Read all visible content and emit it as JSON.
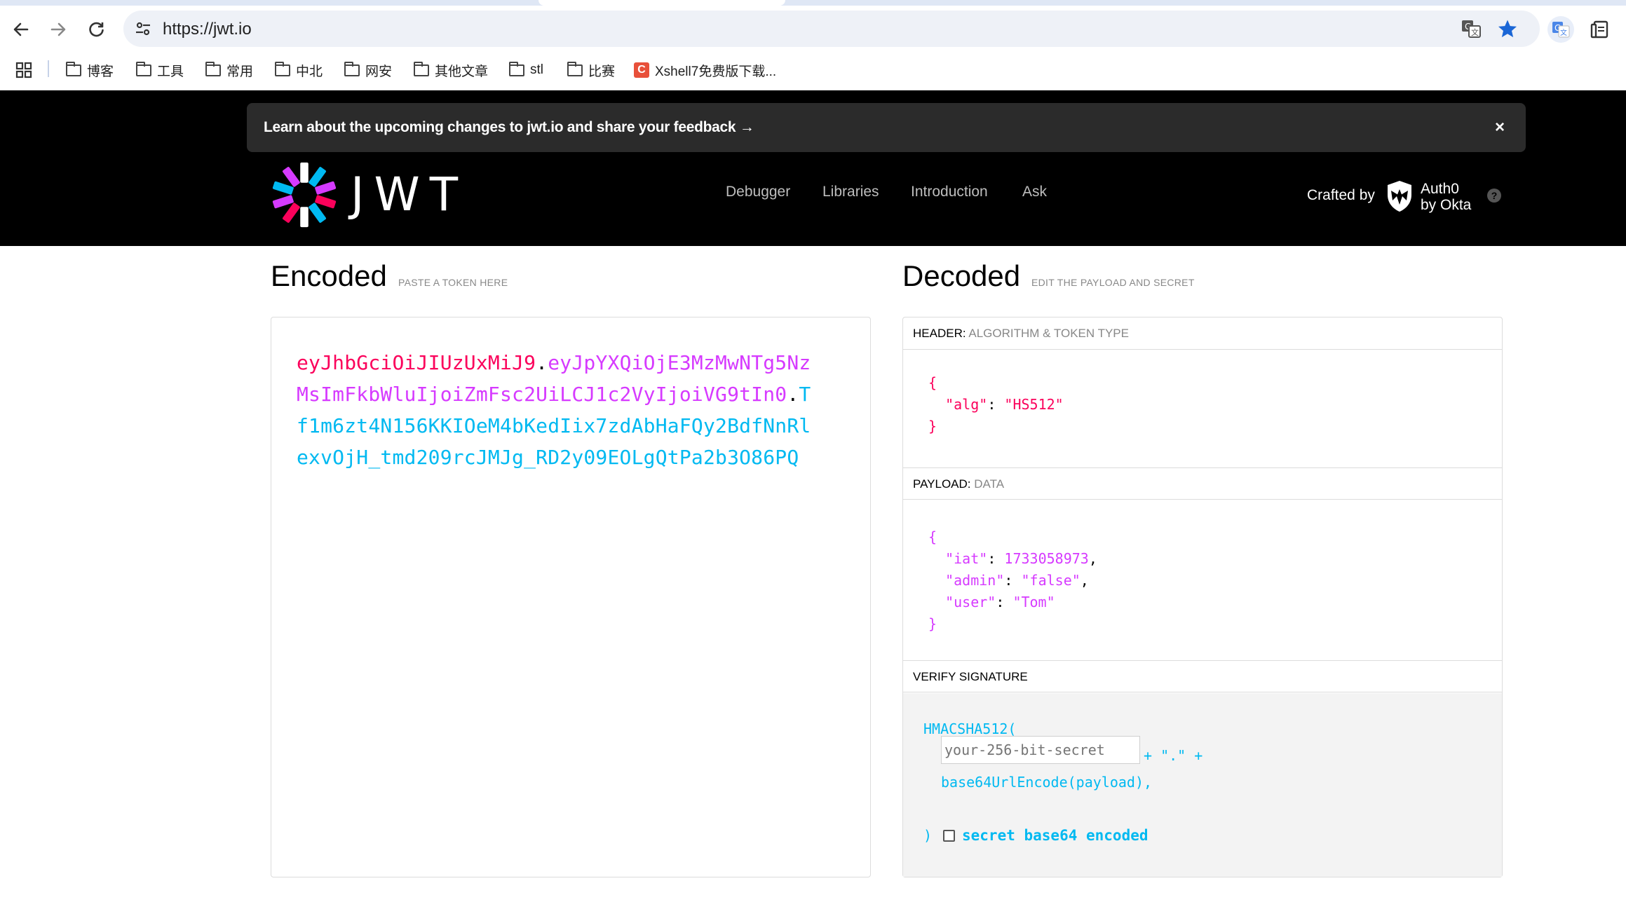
{
  "browser": {
    "url": "https://jwt.io",
    "bookmarks": [
      "博客",
      "工具",
      "常用",
      "中北",
      "网安",
      "其他文章",
      "stl",
      "比赛",
      "Xshell7免费版下载..."
    ]
  },
  "banner": {
    "text": "Learn about the upcoming changes to jwt.io and share your feedback",
    "arrow": "→",
    "close": "×"
  },
  "header": {
    "logo_word": "JWT",
    "nav": [
      "Debugger",
      "Libraries",
      "Introduction",
      "Ask"
    ],
    "crafted_by": "Crafted by",
    "auth0_line1": "Auth0",
    "auth0_line2": "by Okta",
    "help": "?"
  },
  "encoded": {
    "title": "Encoded",
    "subtitle": "PASTE A TOKEN HERE",
    "token_header": "eyJhbGciOiJIUzUxMiJ9",
    "token_payload": "eyJpYXQiOjE3MzMwNTg5NzMsImFkbWluIjoiZmFsc2UiLCJ1c2VyIjoiVG9tIn0",
    "token_signature": "Tf1m6zt4N156KKIOeM4bKedIix7zdAbHaFQy2BdfNnRlexvOjH_tmd209rcJMJg_RD2y09EOLgQtPa2b3O86PQ",
    "dot": "."
  },
  "decoded": {
    "title": "Decoded",
    "subtitle": "EDIT THE PAYLOAD AND SECRET",
    "header_label": "HEADER:",
    "header_desc": "ALGORITHM & TOKEN TYPE",
    "header_alg_key": "\"alg\"",
    "header_alg_val": "\"HS512\"",
    "payload_label": "PAYLOAD:",
    "payload_desc": "DATA",
    "payload_iat_key": "\"iat\"",
    "payload_iat_val": "1733058973",
    "payload_admin_key": "\"admin\"",
    "payload_admin_val": "\"false\"",
    "payload_user_key": "\"user\"",
    "payload_user_val": "\"Tom\"",
    "verify_label": "VERIFY SIGNATURE",
    "sig_line1": "HMACSHA512(",
    "sig_line2": "base64UrlEncode(header) + \".\" +",
    "sig_line3": "base64UrlEncode(payload),",
    "secret_placeholder": "your-256-bit-secret",
    "sig_close": ")",
    "checkbox_label": "secret base64 encoded"
  },
  "colors": {
    "header_red": "#fb015b",
    "payload_purple": "#d63aff",
    "signature_cyan": "#00b9f1"
  }
}
